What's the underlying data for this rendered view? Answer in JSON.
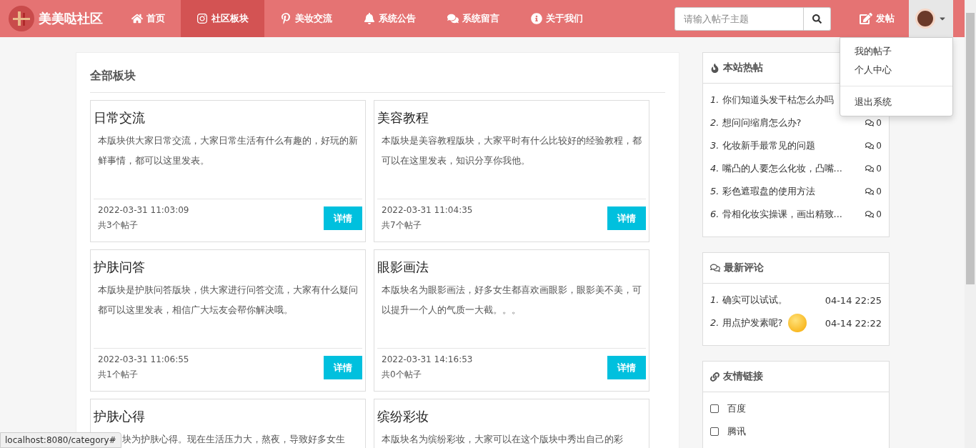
{
  "brand": "美美哒社区",
  "nav": [
    {
      "label": "首页",
      "kind": "home",
      "selected": false
    },
    {
      "label": "社区板块",
      "kind": "camera",
      "selected": true
    },
    {
      "label": "美妆交流",
      "kind": "pin",
      "selected": false
    },
    {
      "label": "系统公告",
      "kind": "bell",
      "selected": false
    },
    {
      "label": "系统留言",
      "kind": "chat",
      "selected": false
    },
    {
      "label": "关于我们",
      "kind": "info",
      "selected": false
    }
  ],
  "search": {
    "placeholder": "请输入帖子主题"
  },
  "post_button": "发帖",
  "user_menu": {
    "expanded": true,
    "items": [
      {
        "label": "我的帖子",
        "kind": "item"
      },
      {
        "label": "个人中心",
        "kind": "item"
      },
      {
        "label": "退出系统",
        "kind": "divided"
      }
    ]
  },
  "section_title": "全部板块",
  "boards": [
    {
      "title": "日常交流",
      "description": "本版块供大家日常交流，大家日常生活有什么有趣的，好玩的新鲜事情，都可以这里发表。",
      "date": "2022-03-31 11:03:09",
      "count": "共3个帖子",
      "button": "详情"
    },
    {
      "title": "美容教程",
      "description": "本版块是美容教程版块，大家平时有什么比较好的经验教程，都可以在这里发表，知识分享你我他。",
      "date": "2022-03-31 11:04:35",
      "count": "共7个帖子",
      "button": "详情"
    },
    {
      "title": "护肤问答",
      "description": "本版块是护肤问答版块，供大家进行问答交流，大家有什么疑问都可以这里发表，相信广大坛友会帮你解决哦。",
      "date": "2022-03-31 11:06:55",
      "count": "共1个帖子",
      "button": "详情"
    },
    {
      "title": "眼影画法",
      "description": "本版块名为眼影画法，好多女生都喜欢画眼影，眼影美不美，可以提升一个人的气质一大截。。。",
      "date": "2022-03-31 14:16:53",
      "count": "共0个帖子",
      "button": "详情"
    },
    {
      "title": "护肤心得",
      "description": "块为护肤心得。现在生活压力大，熬夜，导致好多女生"
    },
    {
      "title": "缤纷彩妆",
      "description": "本版块名为缤纷彩妆，大家可以在这个版块中秀出自己的彩"
    }
  ],
  "hot_posts": {
    "title": "本站热帖",
    "items": [
      {
        "index": "1.",
        "title": "你们知道头发干枯怎么办吗"
      },
      {
        "index": "2.",
        "title": "想问问缩肩怎么办?",
        "comments": "0"
      },
      {
        "index": "3.",
        "title": "化妆新手最常见的问题",
        "comments": "0"
      },
      {
        "index": "4.",
        "title": "嘴凸的人要怎么化妆，凸嘴...",
        "comments": "0"
      },
      {
        "index": "5.",
        "title": "彩色遮瑕盘的使用方法",
        "comments": "0"
      },
      {
        "index": "6.",
        "title": "骨相化妆实操课，画出精致...",
        "comments": "0"
      }
    ]
  },
  "latest_comments": {
    "title": "最新评论",
    "items": [
      {
        "index": "1.",
        "text": "确实可以试试。",
        "emoji": false,
        "time": "04-14 22:25"
      },
      {
        "index": "2.",
        "text": "用点护发素呢?",
        "emoji": true,
        "time": "04-14 22:22"
      }
    ]
  },
  "links": {
    "title": "友情链接",
    "items": [
      {
        "label": "百度",
        "checked": false
      },
      {
        "label": "腾讯",
        "checked": false
      }
    ]
  },
  "status_bar": "localhost:8080/category#"
}
